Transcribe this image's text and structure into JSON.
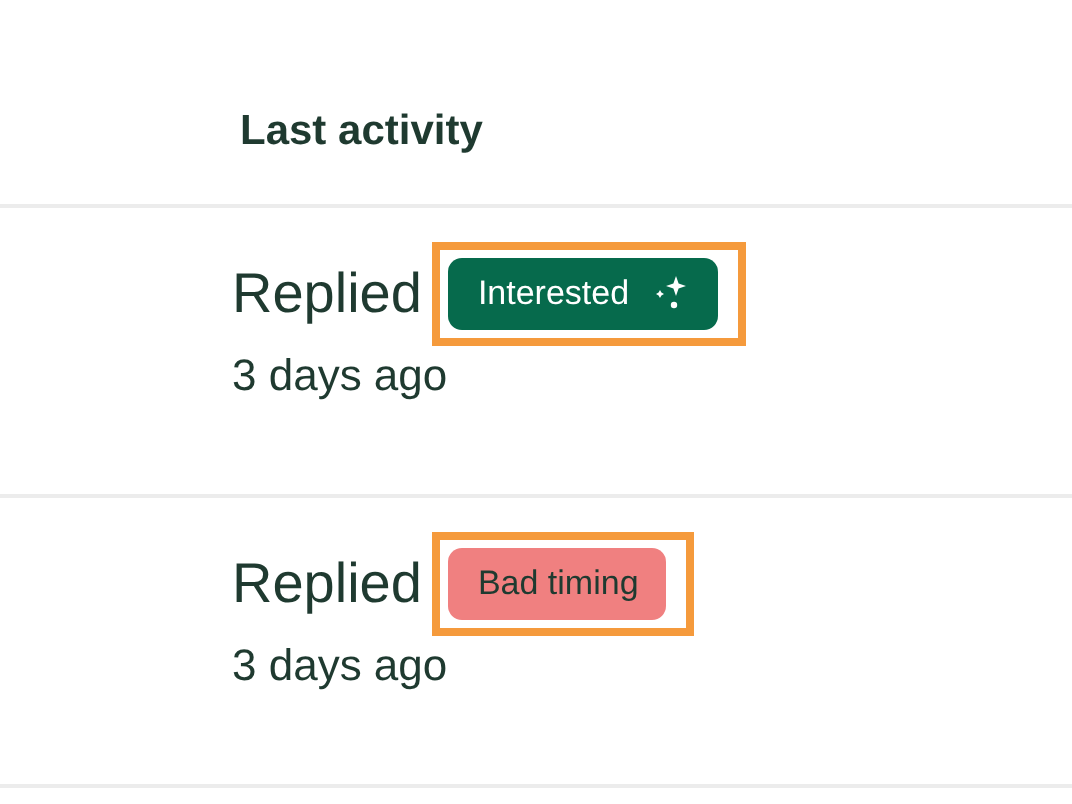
{
  "column_header": "Last activity",
  "rows": [
    {
      "status": "Replied",
      "tag": {
        "label": "Interested",
        "color": "#066a4c",
        "sparkle": true,
        "highlighted": true
      },
      "time": "3 days ago"
    },
    {
      "status": "Replied",
      "tag": {
        "label": "Bad timing",
        "color": "#f08080",
        "sparkle": false,
        "highlighted": true
      },
      "time": "3 days ago"
    }
  ]
}
